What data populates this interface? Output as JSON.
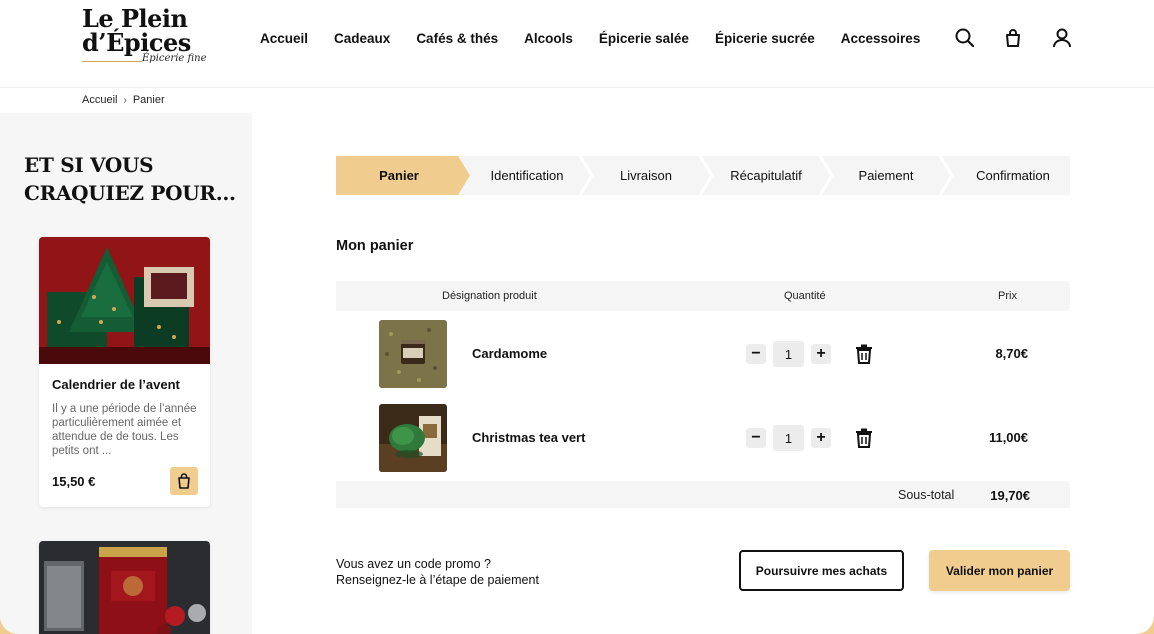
{
  "brand": {
    "name_line1": "Le Plein",
    "name_line2": "d’Épices",
    "tagline": "Épicerie fine",
    "accent_color": "#f0cc8e"
  },
  "nav": {
    "items": [
      "Accueil",
      "Cadeaux",
      "Cafés & thés",
      "Alcools",
      "Épicerie salée",
      "Épicerie sucrée",
      "Accessoires"
    ]
  },
  "header_icons": [
    "search-icon",
    "shopping-bag-icon",
    "user-icon"
  ],
  "breadcrumb": {
    "items": [
      "Accueil",
      "Panier"
    ],
    "separator": "›"
  },
  "sidebar": {
    "title": "ET SI VOUS CRAQUIEZ POUR...",
    "cards": [
      {
        "name": "Calendrier de l’avent",
        "description": "Il y a une période de l’année particulièrement aimée et attendue de de tous. Les petits ont ...",
        "price": "15,50 €"
      }
    ]
  },
  "steps": {
    "items": [
      "Panier",
      "Identification",
      "Livraison",
      "Récapitulatif",
      "Paiement",
      "Confirmation"
    ],
    "active": "Panier"
  },
  "cart": {
    "title": "Mon panier",
    "columns": {
      "product": "Désignation produit",
      "quantity": "Quantité",
      "price": "Prix"
    },
    "items": [
      {
        "name": "Cardamome",
        "quantity": "1",
        "price": "8,70€"
      },
      {
        "name": "Christmas tea vert",
        "quantity": "1",
        "price": "11,00€"
      }
    ],
    "subtotal_label": "Sous-total",
    "subtotal_value": "19,70€",
    "qty_minus": "−",
    "qty_plus": "+"
  },
  "promo": {
    "line1": "Vous avez un code promo ?",
    "line2": "Renseignez-le à l’étape de paiement"
  },
  "actions": {
    "continue_label": "Poursuivre mes achats",
    "validate_label": "Valider mon panier"
  }
}
